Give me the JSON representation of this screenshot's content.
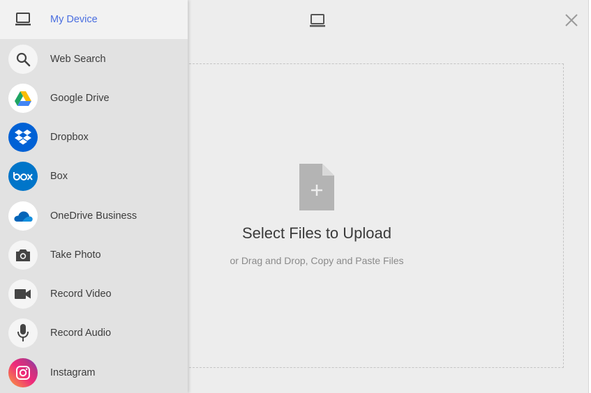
{
  "sidebar": {
    "items": [
      {
        "label": "My Device",
        "icon": "laptop-icon",
        "active": true
      },
      {
        "label": "Web Search",
        "icon": "search-icon"
      },
      {
        "label": "Google Drive",
        "icon": "google-drive-icon"
      },
      {
        "label": "Dropbox",
        "icon": "dropbox-icon"
      },
      {
        "label": "Box",
        "icon": "box-icon"
      },
      {
        "label": "OneDrive Business",
        "icon": "onedrive-icon"
      },
      {
        "label": "Take Photo",
        "icon": "camera-icon"
      },
      {
        "label": "Record Video",
        "icon": "video-camera-icon"
      },
      {
        "label": "Record Audio",
        "icon": "microphone-icon"
      },
      {
        "label": "Instagram",
        "icon": "instagram-icon"
      }
    ]
  },
  "header": {
    "icon": "laptop-icon"
  },
  "close": {
    "icon": "close-icon"
  },
  "dropzone": {
    "icon": "file-add-icon",
    "title": "Select Files to Upload",
    "subtitle": "or Drag and Drop, Copy and Paste Files"
  },
  "colors": {
    "accent": "#4a6ee0",
    "dropbox": "#0061d5",
    "box": "#0075c9",
    "onedrive": "#0364b8"
  }
}
